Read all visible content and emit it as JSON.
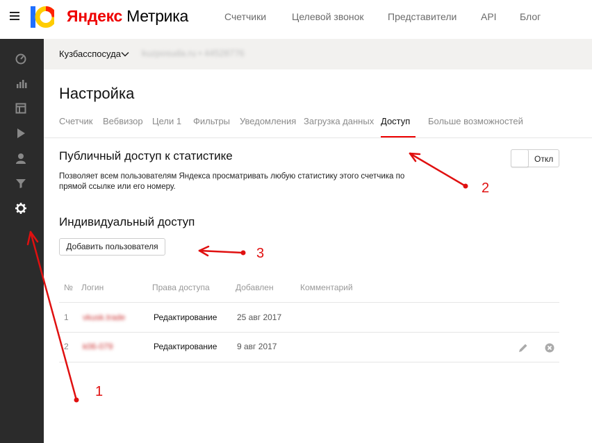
{
  "header": {
    "logo_ya": "Яндекс",
    "logo_metrika": "Метрика",
    "nav": [
      "Счетчики",
      "Целевой звонок",
      "Представители",
      "API",
      "Блог"
    ]
  },
  "sidebar": {
    "icons": [
      "dashboard-icon",
      "reports-icon",
      "summary-icon",
      "webvisor-icon",
      "audience-icon",
      "filter-icon",
      "settings-icon"
    ],
    "active": "settings-icon",
    "bg_color": "#2b2b2b"
  },
  "counter": {
    "name": "Кузбасспосуда",
    "info": "kuzposuda.ru • 44528776"
  },
  "page": {
    "title": "Настройка",
    "tabs": [
      "Счетчик",
      "Вебвизор",
      "Цели 1",
      "Фильтры",
      "Уведомления",
      "Загрузка данных",
      "Доступ",
      "Больше возможностей"
    ],
    "active_tab": "Доступ"
  },
  "public_access": {
    "title": "Публичный доступ к статистике",
    "description": "Позволяет всем пользователям Яндекса просматривать любую статистику этого счетчика по прямой ссылке или его номеру.",
    "toggle_label": "Откл",
    "toggle_on": false
  },
  "individual_access": {
    "title": "Индивидуальный доступ",
    "add_user_label": "Добавить пользователя"
  },
  "table": {
    "columns": [
      "№",
      "Логин",
      "Права доступа",
      "Добавлен",
      "Комментарий"
    ],
    "rows": [
      {
        "num": "1",
        "login": "vkusk.trade",
        "rights": "Редактирование",
        "added": "25 авг 2017",
        "comment": ""
      },
      {
        "num": "2",
        "login": "k06-079",
        "rights": "Редактирование",
        "added": "9 авг 2017",
        "comment": ""
      }
    ]
  },
  "annotations": [
    "1",
    "2",
    "3"
  ],
  "colors": {
    "accent": "#e00000",
    "logo_yellow": "#ffcc00",
    "logo_red": "#ff2200",
    "logo_blue": "#1f6fff",
    "annotation": "#e01010"
  }
}
